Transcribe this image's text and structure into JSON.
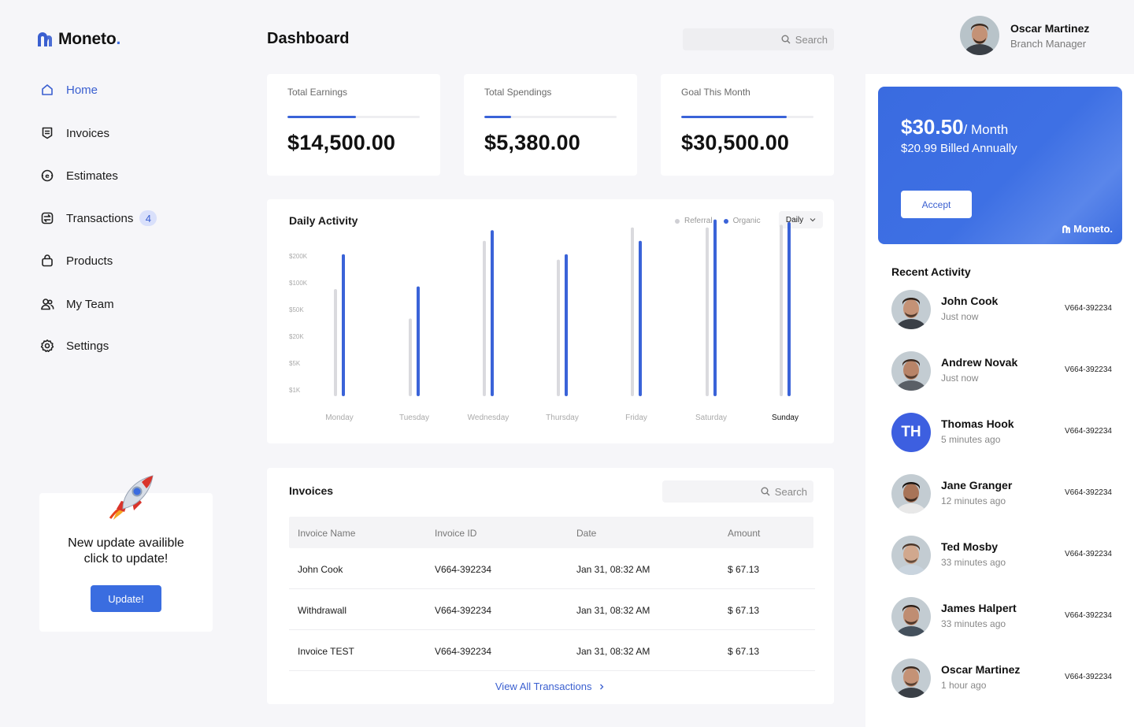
{
  "brand": {
    "name": "Moneto",
    "dot": "."
  },
  "sidebar": {
    "items": [
      {
        "label": "Home",
        "icon": "home-icon",
        "active": true
      },
      {
        "label": "Invoices",
        "icon": "invoice-icon"
      },
      {
        "label": "Estimates",
        "icon": "estimate-icon"
      },
      {
        "label": "Transactions",
        "icon": "transactions-icon",
        "badge": "4"
      },
      {
        "label": "Products",
        "icon": "bag-icon"
      },
      {
        "label": "My Team",
        "icon": "team-icon"
      },
      {
        "label": "Settings",
        "icon": "gear-icon"
      }
    ],
    "update": {
      "text": "New update availible click to update!",
      "button": "Update!"
    }
  },
  "header": {
    "title": "Dashboard",
    "search_placeholder": "Search",
    "user": {
      "name": "Oscar Martinez",
      "role": "Branch Manager"
    }
  },
  "stats": [
    {
      "title": "Total Earnings",
      "value": "$14,500.00",
      "progress": 0.52
    },
    {
      "title": "Total Spendings",
      "value": "$5,380.00",
      "progress": 0.2
    },
    {
      "title": "Goal This Month",
      "value": "$30,500.00",
      "progress": 0.8
    }
  ],
  "activity": {
    "title": "Daily Activity",
    "dropdown": "Daily",
    "legend": {
      "referral": "Referral",
      "organic": "Organic"
    }
  },
  "chart_data": {
    "type": "bar",
    "categories": [
      "Monday",
      "Tuesday",
      "Wednesday",
      "Thursday",
      "Friday",
      "Saturday",
      "Sunday"
    ],
    "y_ticks": [
      "$200K",
      "$100K",
      "$50K",
      "$20K",
      "$5K",
      "$1K"
    ],
    "series": [
      {
        "name": "Referral",
        "color": "#dadade",
        "values": [
          4.0,
          2.9,
          5.8,
          5.1,
          6.3,
          6.3,
          6.4
        ]
      },
      {
        "name": "Organic",
        "color": "#3a63d8",
        "values": [
          5.3,
          4.1,
          6.2,
          5.3,
          5.8,
          6.6,
          6.5
        ]
      }
    ],
    "highlighted_category": "Sunday",
    "ylim": [
      0,
      6.9
    ]
  },
  "invoices": {
    "title": "Invoices",
    "search_placeholder": "Search",
    "columns": [
      "Invoice Name",
      "Invoice ID",
      "Date",
      "Amount"
    ],
    "rows": [
      {
        "name": "John Cook",
        "id": "V664-392234",
        "date": "Jan 31, 08:32 AM",
        "amount": "$ 67.13"
      },
      {
        "name": "Withdrawall",
        "id": "V664-392234",
        "date": "Jan 31, 08:32 AM",
        "amount": "$ 67.13"
      },
      {
        "name": "Invoice TEST",
        "id": "V664-392234",
        "date": "Jan 31, 08:32 AM",
        "amount": "$ 67.13"
      }
    ],
    "view_all": "View All Transactions"
  },
  "promo": {
    "price": "$30.50",
    "period": "/ Month",
    "billed": "$20.99 Billed Annually",
    "button": "Accept",
    "brand": "Moneto."
  },
  "recent_activity": {
    "title": "Recent Activity",
    "items": [
      {
        "name": "John Cook",
        "time": "Just now",
        "id": "V664-392234",
        "avatar": "photo"
      },
      {
        "name": "Andrew Novak",
        "time": "Just now",
        "id": "V664-392234",
        "avatar": "photo"
      },
      {
        "name": "Thomas Hook",
        "time": "5 minutes ago",
        "id": "V664-392234",
        "avatar": "initials",
        "initials": "TH"
      },
      {
        "name": "Jane Granger",
        "time": "12 minutes ago",
        "id": "V664-392234",
        "avatar": "photo"
      },
      {
        "name": "Ted Mosby",
        "time": "33 minutes ago",
        "id": "V664-392234",
        "avatar": "photo"
      },
      {
        "name": "James Halpert",
        "time": "33 minutes ago",
        "id": "V664-392234",
        "avatar": "photo"
      },
      {
        "name": "Oscar Martinez",
        "time": "1 hour ago",
        "id": "V664-392234",
        "avatar": "photo"
      }
    ]
  }
}
